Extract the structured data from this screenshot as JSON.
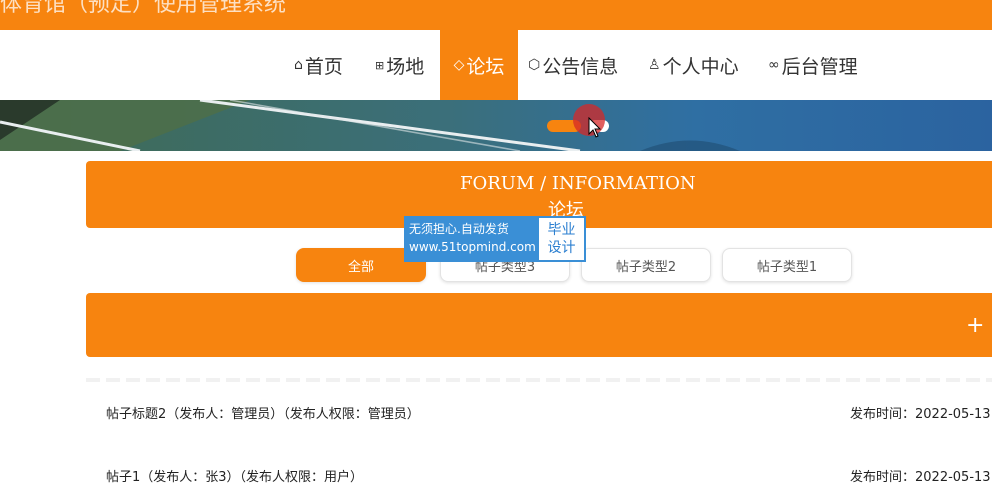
{
  "site": {
    "title": "体育馆（预定）使用管理系统"
  },
  "nav": {
    "items": [
      {
        "icon": "home-icon",
        "glyph": "⌂",
        "label": "首页"
      },
      {
        "icon": "venue-icon",
        "glyph": "⊞",
        "label": "场地"
      },
      {
        "icon": "tag-icon",
        "glyph": "◇",
        "label": "论坛"
      },
      {
        "icon": "cube-icon",
        "glyph": "⬡",
        "label": "公告信息"
      },
      {
        "icon": "user-icon",
        "glyph": "♙",
        "label": "个人中心"
      },
      {
        "icon": "link-icon",
        "glyph": "∞",
        "label": "后台管理"
      }
    ],
    "active_index": 2
  },
  "banner": {
    "slide_count": 2,
    "active_slide": 0
  },
  "section": {
    "title_en": "FORUM / INFORMATION",
    "title_cn": "论坛"
  },
  "watermark": {
    "line1": "无须担心.自动发货",
    "line2": "www.51topmind.com",
    "side1": "毕业",
    "side2": "设计"
  },
  "filters": {
    "items": [
      "全部",
      "帖子类型3",
      "帖子类型2",
      "帖子类型1"
    ],
    "active_index": 0
  },
  "actions": {
    "add_label": "+"
  },
  "posts": [
    {
      "title": "帖子标题2（发布人：管理员）（发布人权限：管理员）",
      "time": "发布时间：2022-05-13"
    },
    {
      "title": "帖子1（发布人：张3）（发布人权限：用户）",
      "time": "发布时间：2022-05-13"
    }
  ],
  "colors": {
    "accent": "#f7840f",
    "watermark_blue": "#3a8fd6"
  }
}
